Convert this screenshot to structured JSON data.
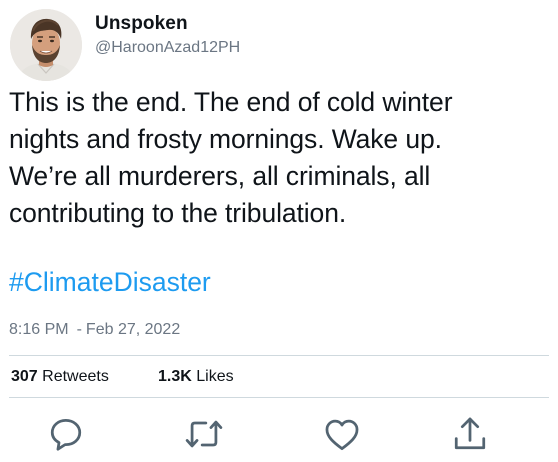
{
  "author": {
    "display_name": "Unspoken",
    "handle": "@HaroonAzad12PH",
    "avatar_icon": "profile-photo"
  },
  "tweet": {
    "lines": [
      "This is the end. The end of cold winter",
      "nights and frosty mornings. Wake up.",
      "We’re all murderers, all criminals, all",
      "contributing to the tribulation."
    ],
    "hashtag": "#ClimateDisaster",
    "time": "8:16 PM",
    "separator": "-",
    "date": "Feb 27, 2022"
  },
  "stats": {
    "retweets_count": "307",
    "retweets_label": "Retweets",
    "likes_count": "1.3K",
    "likes_label": "Likes"
  },
  "actions": [
    {
      "name": "reply",
      "icon": "speech-bubble-icon"
    },
    {
      "name": "retweet",
      "icon": "retweet-arrows-icon"
    },
    {
      "name": "like",
      "icon": "heart-icon"
    },
    {
      "name": "share",
      "icon": "upload-share-icon"
    }
  ],
  "colors": {
    "text": "#0f1419",
    "secondary": "#6b7683",
    "link": "#1d9bf0",
    "divider": "#cfd9de",
    "icon": "#536471"
  }
}
